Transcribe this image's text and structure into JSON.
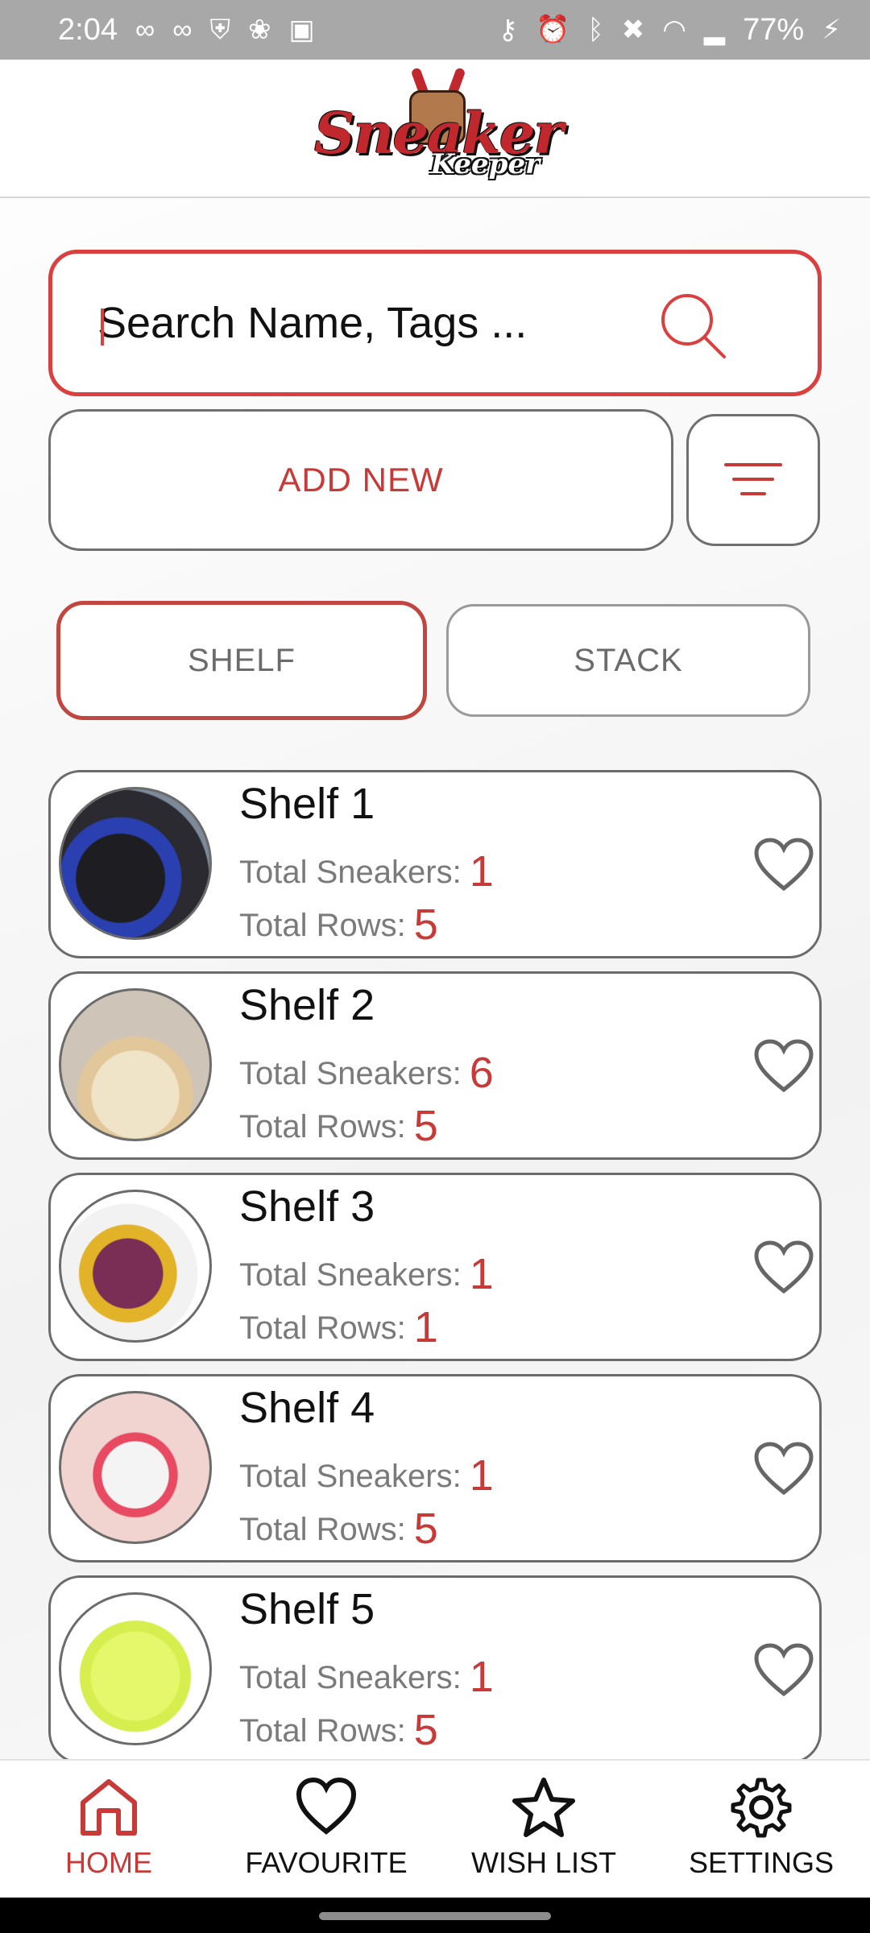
{
  "status_bar": {
    "time": "2:04",
    "battery": "77%",
    "left_icons": [
      "voicemail-icon",
      "infinity-icon",
      "shield-icon",
      "fan-icon",
      "image-icon"
    ],
    "right_icons": [
      "key-icon",
      "alarm-icon",
      "bluetooth-icon",
      "mute-icon",
      "wifi-icon",
      "signal-icon",
      "battery-icon"
    ]
  },
  "header": {
    "logo_text": "Sneaker",
    "logo_subtext": "Keeper"
  },
  "search": {
    "placeholder": "Search Name, Tags ...",
    "icon": "search-icon"
  },
  "actions": {
    "add_new_label": "ADD NEW",
    "filter_icon": "filter-icon"
  },
  "tabs": [
    {
      "label": "SHELF",
      "selected": true
    },
    {
      "label": "STACK",
      "selected": false
    }
  ],
  "shelf_labels": {
    "sneakers": "Total Sneakers:",
    "rows": "Total Rows:"
  },
  "shelves": [
    {
      "name": "Shelf 1",
      "total_sneakers": "1",
      "total_rows": "5",
      "image": "black-blue-sneaker"
    },
    {
      "name": "Shelf 2",
      "total_sneakers": "6",
      "total_rows": "5",
      "image": "cream-sneaker-on-foot"
    },
    {
      "name": "Shelf 3",
      "total_sneakers": "1",
      "total_rows": "1",
      "image": "purple-yellow-sneaker"
    },
    {
      "name": "Shelf 4",
      "total_sneakers": "1",
      "total_rows": "5",
      "image": "white-pink-sneaker"
    },
    {
      "name": "Shelf 5",
      "total_sneakers": "1",
      "total_rows": "5",
      "image": "neon-yellow-sneaker"
    }
  ],
  "bottom_nav": [
    {
      "label": "HOME",
      "icon": "home-icon",
      "active": true
    },
    {
      "label": "FAVOURITE",
      "icon": "heart-icon",
      "active": false
    },
    {
      "label": "WISH LIST",
      "icon": "star-icon",
      "active": false
    },
    {
      "label": "SETTINGS",
      "icon": "gear-icon",
      "active": false
    }
  ],
  "colors": {
    "accent": "#c73a38",
    "border": "#6b6b6b",
    "status_bar": "#a8a8a8"
  }
}
